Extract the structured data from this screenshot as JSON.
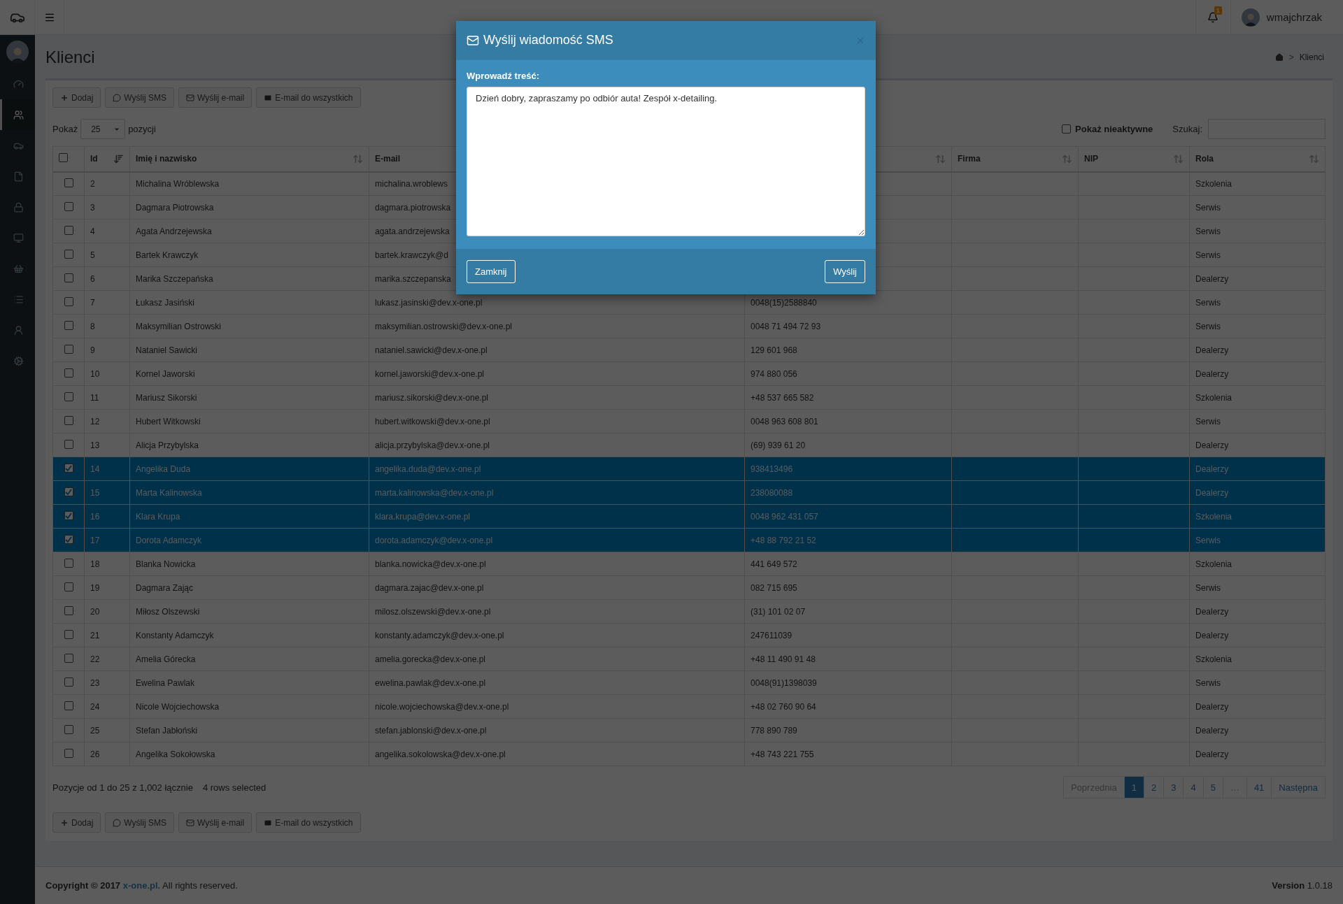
{
  "topbar": {
    "notifications": "1",
    "user": "wmajchrzak"
  },
  "sidebar": {
    "items": [
      {
        "kind": "dashboard",
        "selected": false
      },
      {
        "kind": "users",
        "selected": true
      },
      {
        "kind": "car",
        "selected": false
      },
      {
        "kind": "file",
        "selected": false
      },
      {
        "kind": "lock",
        "selected": false
      },
      {
        "kind": "monitor",
        "selected": false
      },
      {
        "kind": "basket",
        "selected": false
      },
      {
        "kind": "list",
        "selected": false
      },
      {
        "kind": "user-lock",
        "selected": false
      },
      {
        "kind": "cogs",
        "selected": false
      }
    ]
  },
  "page": {
    "title": "Klienci",
    "breadcrumb": {
      "separator": ">",
      "current": "Klienci"
    }
  },
  "toolbar": [
    {
      "kind": "add",
      "label": "Dodaj"
    },
    {
      "kind": "sms",
      "label": "Wyślij SMS"
    },
    {
      "kind": "email",
      "label": "Wyślij e-mail"
    },
    {
      "kind": "email-all",
      "label": "E-mail do wszystkich"
    }
  ],
  "length": {
    "label": "Pokaż",
    "value": "25",
    "suffix": "pozycji"
  },
  "show_inactive": {
    "label": "Pokaż nieaktywne",
    "checked": false
  },
  "search": {
    "label": "Szukaj:"
  },
  "table": {
    "select_all": {
      "checked": false
    },
    "columns": [
      {
        "label": "Id",
        "sortable": true,
        "sorted": true
      },
      {
        "label": "Imię i nazwisko",
        "sortable": true,
        "sorted": false
      },
      {
        "label": "E-mail"
      },
      {
        "sortable": true,
        "sorted": false
      },
      {
        "label": "Firma",
        "sortable": true,
        "sorted": false
      },
      {
        "label": "NIP",
        "sortable": true,
        "sorted": false
      },
      {
        "label": "Rola",
        "sortable": true,
        "sorted": false
      }
    ],
    "rows": [
      {
        "id": "2",
        "name": "Michalina Wróblewska",
        "email": "michalina.wroblews",
        "role": "Szkolenia",
        "selected": false
      },
      {
        "id": "3",
        "name": "Dagmara Piotrowska",
        "email": "dagmara.piotrowska",
        "role": "Serwis",
        "selected": false
      },
      {
        "id": "4",
        "name": "Agata Andrzejewska",
        "email": "agata.andrzejewska",
        "role": "Serwis",
        "selected": false
      },
      {
        "id": "5",
        "name": "Bartek Krawczyk",
        "email": "bartek.krawczyk@d",
        "role": "Serwis",
        "selected": false
      },
      {
        "id": "6",
        "name": "Marika Szczepańska",
        "email": "marika.szczepanska",
        "role": "Dealerzy",
        "selected": false
      },
      {
        "id": "7",
        "name": "Łukasz Jasiński",
        "email": "lukasz.jasinski@dev.x-one.pl",
        "phone": "0048(15)2588840",
        "role": "Serwis",
        "selected": false
      },
      {
        "id": "8",
        "name": "Maksymilian Ostrowski",
        "email": "maksymilian.ostrowski@dev.x-one.pl",
        "phone": "0048 71 494 72 93",
        "role": "Serwis",
        "selected": false
      },
      {
        "id": "9",
        "name": "Nataniel Sawicki",
        "email": "nataniel.sawicki@dev.x-one.pl",
        "phone": "129 601 968",
        "role": "Dealerzy",
        "selected": false
      },
      {
        "id": "10",
        "name": "Kornel Jaworski",
        "email": "kornel.jaworski@dev.x-one.pl",
        "phone": "974 880 056",
        "role": "Dealerzy",
        "selected": false
      },
      {
        "id": "11",
        "name": "Mariusz Sikorski",
        "email": "mariusz.sikorski@dev.x-one.pl",
        "phone": "+48 537 665 582",
        "role": "Szkolenia",
        "selected": false
      },
      {
        "id": "12",
        "name": "Hubert Witkowski",
        "email": "hubert.witkowski@dev.x-one.pl",
        "phone": "0048 963 608 801",
        "role": "Serwis",
        "selected": false
      },
      {
        "id": "13",
        "name": "Alicja Przybylska",
        "email": "alicja.przybylska@dev.x-one.pl",
        "phone": "(69) 939 61 20",
        "role": "Dealerzy",
        "selected": false
      },
      {
        "id": "14",
        "name": "Angelika Duda",
        "email": "angelika.duda@dev.x-one.pl",
        "phone": "938413496",
        "role": "Dealerzy",
        "selected": true
      },
      {
        "id": "15",
        "name": "Marta Kalinowska",
        "email": "marta.kalinowska@dev.x-one.pl",
        "phone": "238080088",
        "role": "Dealerzy",
        "selected": true
      },
      {
        "id": "16",
        "name": "Klara Krupa",
        "email": "klara.krupa@dev.x-one.pl",
        "phone": "0048 962 431 057",
        "role": "Szkolenia",
        "selected": true
      },
      {
        "id": "17",
        "name": "Dorota Adamczyk",
        "email": "dorota.adamczyk@dev.x-one.pl",
        "phone": "+48 88 792 21 52",
        "role": "Serwis",
        "selected": true
      },
      {
        "id": "18",
        "name": "Blanka Nowicka",
        "email": "blanka.nowicka@dev.x-one.pl",
        "phone": "441 649 572",
        "role": "Szkolenia",
        "selected": false
      },
      {
        "id": "19",
        "name": "Dagmara Zając",
        "email": "dagmara.zajac@dev.x-one.pl",
        "phone": "082 715 695",
        "role": "Serwis",
        "selected": false
      },
      {
        "id": "20",
        "name": "Miłosz Olszewski",
        "email": "milosz.olszewski@dev.x-one.pl",
        "phone": "(31) 101 02 07",
        "role": "Dealerzy",
        "selected": false
      },
      {
        "id": "21",
        "name": "Konstanty Adamczyk",
        "email": "konstanty.adamczyk@dev.x-one.pl",
        "phone": "247611039",
        "role": "Dealerzy",
        "selected": false
      },
      {
        "id": "22",
        "name": "Amelia Górecka",
        "email": "amelia.gorecka@dev.x-one.pl",
        "phone": "+48 11 490 91 48",
        "role": "Szkolenia",
        "selected": false
      },
      {
        "id": "23",
        "name": "Ewelina Pawlak",
        "email": "ewelina.pawlak@dev.x-one.pl",
        "phone": "0048(91)1398039",
        "role": "Serwis",
        "selected": false
      },
      {
        "id": "24",
        "name": "Nicole Wojciechowska",
        "email": "nicole.wojciechowska@dev.x-one.pl",
        "phone": "+48 02 760 90 64",
        "role": "Dealerzy",
        "selected": false
      },
      {
        "id": "25",
        "name": "Stefan Jabłoński",
        "email": "stefan.jablonski@dev.x-one.pl",
        "phone": "778 890 789",
        "role": "Dealerzy",
        "selected": false
      },
      {
        "id": "26",
        "name": "Angelika Sokołowska",
        "email": "angelika.sokolowska@dev.x-one.pl",
        "phone": "+48 743 221 755",
        "role": "Dealerzy",
        "selected": false
      }
    ]
  },
  "info": {
    "text": "Pozycje od 1 do 25 z 1,002 łącznie",
    "selection": "4 rows selected"
  },
  "pagination": [
    {
      "label": "Poprzednia",
      "selected": false,
      "disabled": true
    },
    {
      "label": "1",
      "selected": true,
      "disabled": false
    },
    {
      "label": "2",
      "selected": false,
      "disabled": false
    },
    {
      "label": "3",
      "selected": false,
      "disabled": false
    },
    {
      "label": "4",
      "selected": false,
      "disabled": false
    },
    {
      "label": "5",
      "selected": false,
      "disabled": false
    },
    {
      "label": "…",
      "selected": false,
      "disabled": true
    },
    {
      "label": "41",
      "selected": false,
      "disabled": false
    },
    {
      "label": "Następna",
      "selected": false,
      "disabled": false
    }
  ],
  "bottom_toolbar": [
    {
      "kind": "add",
      "label": "Dodaj"
    },
    {
      "kind": "sms",
      "label": "Wyślij SMS"
    },
    {
      "kind": "email",
      "label": "Wyślij e-mail"
    },
    {
      "kind": "email-all",
      "label": "E-mail do wszystkich"
    }
  ],
  "footer": {
    "copyright": "Copyright © 2017",
    "link": "x-one.pl.",
    "rights": "All rights reserved.",
    "version_label": "Version",
    "version": "1.0.18"
  },
  "modal": {
    "title": "Wyślij wiadomość SMS",
    "label": "Wprowadź treść:",
    "message": "Dzień dobry, zapraszamy po odbiór auta! Zespół x-detailing.",
    "buttons": [
      "Zamknij",
      "Wyślij"
    ]
  }
}
